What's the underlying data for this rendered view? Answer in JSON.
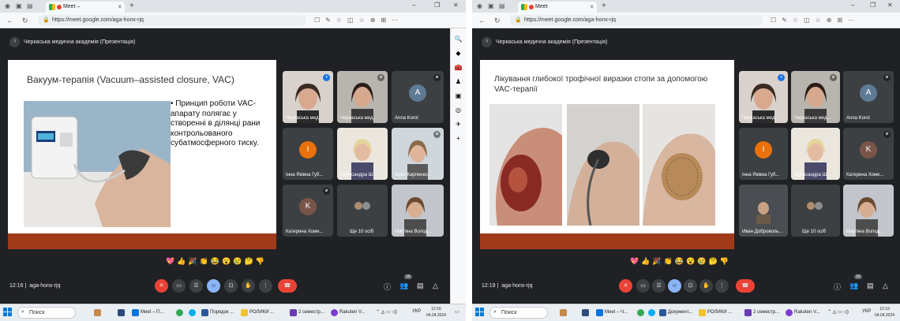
{
  "left": {
    "tab_title": "Meet –",
    "url": "https://meet.google.com/aga-honx-rjq",
    "meeting_title": "Черкаська медична академія (Презентація)",
    "badge": "Ч",
    "slide_title": "Вакуум-терапія (Vacuum–assisted closure, VAC)",
    "bullet": "• Принцип роботи VAC-апарату полягає у створенні в ділянці рани контрольованого субатмосферного тиску.",
    "tiles": [
      {
        "name": "Черкаська мед...",
        "kind": "video"
      },
      {
        "name": "Черкаська мед...",
        "kind": "video"
      },
      {
        "name": "Anna Korol",
        "initial": "A",
        "color": "#5f7a94"
      },
      {
        "name": "Інна Яківна Губ...",
        "initial": "I",
        "color": "#e8710a"
      },
      {
        "name": "Олександра Ш...",
        "kind": "video"
      },
      {
        "name": "Юлія Карпенко...",
        "kind": "video"
      },
      {
        "name": "Катерина Хоме...",
        "initial": "K",
        "color": "#795548"
      },
      {
        "name": "Ще 10 осіб",
        "kind": "group"
      },
      {
        "name": "Мар'яна Волод...",
        "kind": "video"
      }
    ],
    "time": "12:16",
    "code": "aga-honx-rjq",
    "participants": "19",
    "clock_time": "12:16",
    "clock_date": "04.04.2024"
  },
  "right": {
    "tab_title": "Meet",
    "url": "https://meet.google.com/aga-honx-rjq",
    "meeting_title": "Черкаська медична академія (Презентація)",
    "badge": "Ч",
    "slide_title": "Лікування глибокої трофічної виразки стопи за допомогою VAC-терапії",
    "tiles": [
      {
        "name": "Черкаська мед...",
        "kind": "video"
      },
      {
        "name": "Черкаська мед...",
        "kind": "video"
      },
      {
        "name": "Anna Korol",
        "initial": "A",
        "color": "#5f7a94"
      },
      {
        "name": "Інна Яківна Губ...",
        "initial": "I",
        "color": "#e8710a"
      },
      {
        "name": "Олександра Ш...",
        "kind": "video"
      },
      {
        "name": "Катерина Хоме...",
        "initial": "K",
        "color": "#795548"
      },
      {
        "name": "Иван Доброволь...",
        "kind": "video"
      },
      {
        "name": "Ще 10 осіб",
        "kind": "group"
      },
      {
        "name": "Мар'яна Волод...",
        "kind": "video"
      }
    ],
    "time": "12:19",
    "code": "aga-honx-rjq",
    "participants": "19",
    "clock_time": "12:19",
    "clock_date": "04.04.2024"
  },
  "taskbar": {
    "search": "Поиск",
    "lang": "УКР",
    "left_tasks": [
      "Meet – П...",
      "Порядок ...",
      "РОЛИКИ ...",
      "2 семестр...",
      "Rakuten V..."
    ],
    "right_tasks": [
      "Meet – Ч...",
      "Документ...",
      "РОЛИКИ ...",
      "2 семестр...",
      "Rakuten V..."
    ]
  },
  "reactions": "💖👍🎉👏😂😮😢🤔👎",
  "colors": {
    "accent_red": "#ea4335",
    "slide_bar": "#a03a1a",
    "meet_bg": "#202124",
    "tile_bg": "#3c4043"
  }
}
